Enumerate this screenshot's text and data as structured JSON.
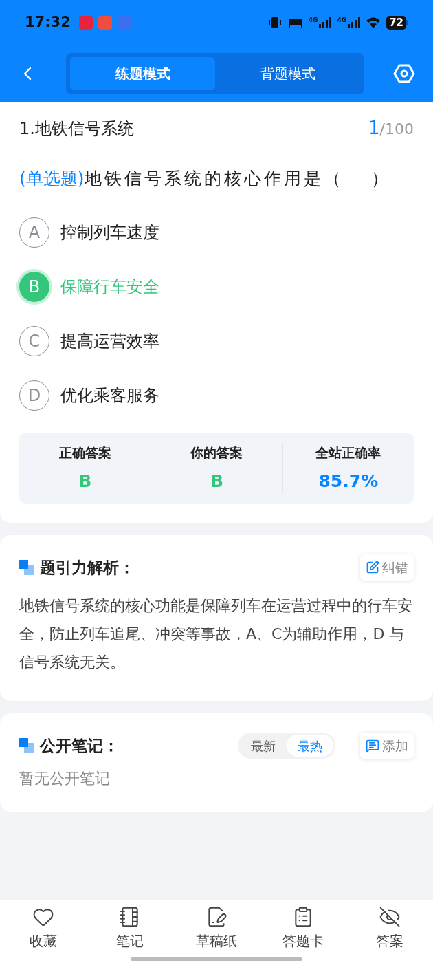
{
  "status_bar": {
    "time": "17:32",
    "network_labels": [
      "4G",
      "4G"
    ],
    "battery": "72"
  },
  "nav": {
    "tabs": [
      {
        "label": "练题模式",
        "selected": true
      },
      {
        "label": "背题模式",
        "selected": false
      }
    ]
  },
  "question_header": {
    "title": "1.地铁信号系统",
    "current": "1",
    "total": "/100"
  },
  "question": {
    "type_label": "(单选题)",
    "text": "地铁信号系统的核心作用是（　 ）"
  },
  "options": [
    {
      "letter": "A",
      "text": "控制列车速度",
      "selected": false
    },
    {
      "letter": "B",
      "text": "保障行车安全",
      "selected": true
    },
    {
      "letter": "C",
      "text": "提高运营效率",
      "selected": false
    },
    {
      "letter": "D",
      "text": "优化乘客服务",
      "selected": false
    }
  ],
  "result": [
    {
      "label": "正确答案",
      "value": "B",
      "kind": "answer"
    },
    {
      "label": "你的答案",
      "value": "B",
      "kind": "answer"
    },
    {
      "label": "全站正确率",
      "value": "85.7%",
      "kind": "rate"
    }
  ],
  "analysis": {
    "title": "题引力解析：",
    "action": "纠错",
    "body": "地铁信号系统的核心功能是保障列车在运营过程中的行车安全，防止列车追尾、冲突等事故，A、C为辅助作用，D 与信号系统无关。"
  },
  "notes": {
    "title": "公开笔记：",
    "sort_tabs": [
      {
        "label": "最新",
        "selected": false
      },
      {
        "label": "最热",
        "selected": true
      }
    ],
    "action": "添加",
    "empty": "暂无公开笔记"
  },
  "bottom_bar": [
    {
      "label": "收藏",
      "kind": "favorite"
    },
    {
      "label": "笔记",
      "kind": "notebook"
    },
    {
      "label": "草稿纸",
      "kind": "draft"
    },
    {
      "label": "答题卡",
      "kind": "card"
    },
    {
      "label": "答案",
      "kind": "answer"
    }
  ]
}
